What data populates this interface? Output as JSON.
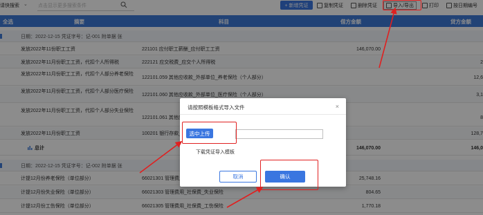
{
  "toolbar": {
    "quick_search_label": "请快搜索",
    "search_placeholder": "点击显示更多搜索条件",
    "new_voucher": "+ 新增凭证",
    "copy_voucher": "复制凭证",
    "delete_voucher": "删除凭证",
    "import_export": "导入/导出",
    "print": "打印",
    "sort_by_date": "按日期编号"
  },
  "table": {
    "headers": {
      "select_all": "全选",
      "summary": "摘要",
      "subject": "科目",
      "debit": "借方金额",
      "credit": "贷方金额"
    },
    "voucher1": {
      "meta": "日期：2022-12-15   凭证字号：记-001    附单据  张",
      "rows": [
        {
          "summary": "发放2022年11份职工工资",
          "subject": "221101 应付职工薪酬_应付职工工资",
          "debit": "146,070.00",
          "credit": ""
        },
        {
          "summary": "发放2022年11月份职工工资，代扣个人所得税",
          "subject": "222121 应交税费_应交个人所得税",
          "debit": "",
          "credit": "2"
        },
        {
          "summary": "发放2022年11月份职工工资，代扣个人部分养老保险",
          "subject": "122101.059 其他应收款_外部单位_养老保险（个人部分）",
          "debit": "",
          "credit": "12,6"
        },
        {
          "summary": "发放2022年11月份职工工资，代扣个人部分医疗保险",
          "subject": "122101.060 其他应收款_外部单位_医疗保险（个人部分）",
          "debit": "",
          "credit": "3,1"
        },
        {
          "summary": "发放2022年11月份职工工资，代扣个人部分失业保险",
          "subject": "122101.061 其他应收款_外部单位_失业保险（个人部分）",
          "debit": "",
          "credit": "8"
        },
        {
          "summary": "发放2022年11月份职工工资",
          "subject": "100201 银行存款_基本户",
          "debit": "",
          "credit": "128,7"
        }
      ],
      "total_label": "总计",
      "total_debit": "146,070.00",
      "total_credit": "146,0"
    },
    "voucher2": {
      "meta": "日期：2022-12-15   凭证字号：记-002    附单据  张",
      "rows": [
        {
          "summary": "计提12月份养老保险（单位部分）",
          "subject": "66021301 管理费用_社保费_养老保险",
          "debit": "25,748.16",
          "credit": ""
        },
        {
          "summary": "计提12月份失业保险（单位部分）",
          "subject": "66021303 管理费用_社保费_失业保险",
          "debit": "804.65",
          "credit": ""
        },
        {
          "summary": "计提12月份工伤保险（单位部分）",
          "subject": "66021305 管理费用_社保费_工伤保险",
          "debit": "1,770.18",
          "credit": ""
        }
      ]
    }
  },
  "dialog": {
    "title": "请按照模板格式导入文件",
    "close": "×",
    "upload_button": "选中上传",
    "file_value": "",
    "download_template": "下载凭证导入模板",
    "cancel": "取消",
    "confirm": "确认"
  },
  "colors": {
    "primary": "#3a76e0",
    "header_bg": "#3e7ad8",
    "highlight": "#e02020"
  }
}
